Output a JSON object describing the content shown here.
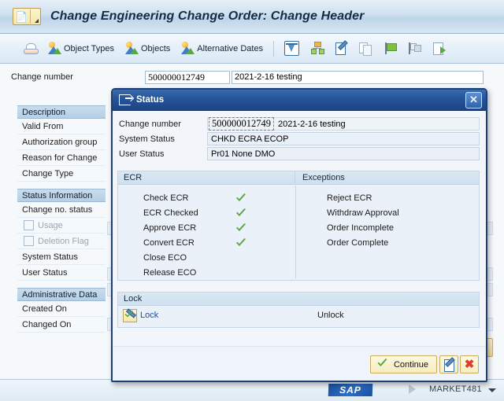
{
  "window": {
    "title": "Change Engineering Change Order: Change Header",
    "system_icon": "sap-document-icon"
  },
  "toolbar": {
    "items": [
      {
        "label": "",
        "icon": "hat-icon"
      },
      {
        "label": "Object Types",
        "icon": "mountain-sun-icon"
      },
      {
        "label": "Objects",
        "icon": "mountain-sun-icon"
      },
      {
        "label": "Alternative Dates",
        "icon": "mountain-sun-icon"
      },
      {
        "label": "",
        "icon": "filter-icon"
      },
      {
        "label": "",
        "icon": "hierarchy-icon"
      },
      {
        "label": "",
        "icon": "note-edit-icon"
      },
      {
        "label": "",
        "icon": "copy-icon"
      },
      {
        "label": "",
        "icon": "green-flag-icon"
      },
      {
        "label": "",
        "icon": "two-flags-icon"
      },
      {
        "label": "",
        "icon": "document-export-icon"
      }
    ]
  },
  "form": {
    "change_number_label": "Change number",
    "change_number_value": "500000012749",
    "change_description_value": "2021-2-16 testing",
    "groups": [
      {
        "header": "Description",
        "rows": [
          "Valid From",
          "Authorization group",
          "Reason for Change",
          "Change Type"
        ]
      },
      {
        "header": "Status Information",
        "rows": [
          "Change no. status",
          "Usage",
          "Deletion Flag",
          "System Status",
          "User Status"
        ],
        "checkbox_rows": [
          "Usage",
          "Deletion Flag"
        ]
      },
      {
        "header": "Administrative Data",
        "rows": [
          "Created On",
          "Changed On"
        ]
      }
    ]
  },
  "dialog": {
    "title": "Status",
    "close_label": "✕",
    "fields": [
      {
        "label": "Change number",
        "value": "500000012749",
        "extra": "2021-2-16 testing",
        "highlighted": true
      },
      {
        "label": "System Status",
        "value": "CHKD ECRA ECOP",
        "extra": "",
        "highlighted": false
      },
      {
        "label": "User Status",
        "value": "Pr01 None DMO",
        "extra": "",
        "highlighted": false
      }
    ],
    "ecr": {
      "header": "ECR",
      "items": [
        {
          "label": "Check ECR",
          "checked": true
        },
        {
          "label": "ECR Checked",
          "checked": true
        },
        {
          "label": "Approve ECR",
          "checked": true
        },
        {
          "label": "Convert ECR",
          "checked": true
        },
        {
          "label": "Close ECO",
          "checked": false
        },
        {
          "label": "Release ECO",
          "checked": false
        }
      ]
    },
    "exceptions": {
      "header": "Exceptions",
      "items": [
        {
          "label": "Reject ECR",
          "checked": false
        },
        {
          "label": "Withdraw Approval",
          "checked": false
        },
        {
          "label": "Order Incomplete",
          "checked": false
        },
        {
          "label": "Order Complete",
          "checked": false
        }
      ]
    },
    "lock": {
      "header": "Lock",
      "locked_label": "Lock",
      "unlock_label": "Unlock"
    },
    "footer": {
      "continue_label": "Continue",
      "edit_icon": "note-edit-icon",
      "cancel_icon": "red-x-icon"
    }
  },
  "statusbar": {
    "logo": "SAP",
    "system": "MARKET481"
  },
  "colors": {
    "title_blue": "#1c4385",
    "accent_check": "#5aa845",
    "highlight_red": "#e2545c",
    "link_blue": "#1b4fa0"
  }
}
